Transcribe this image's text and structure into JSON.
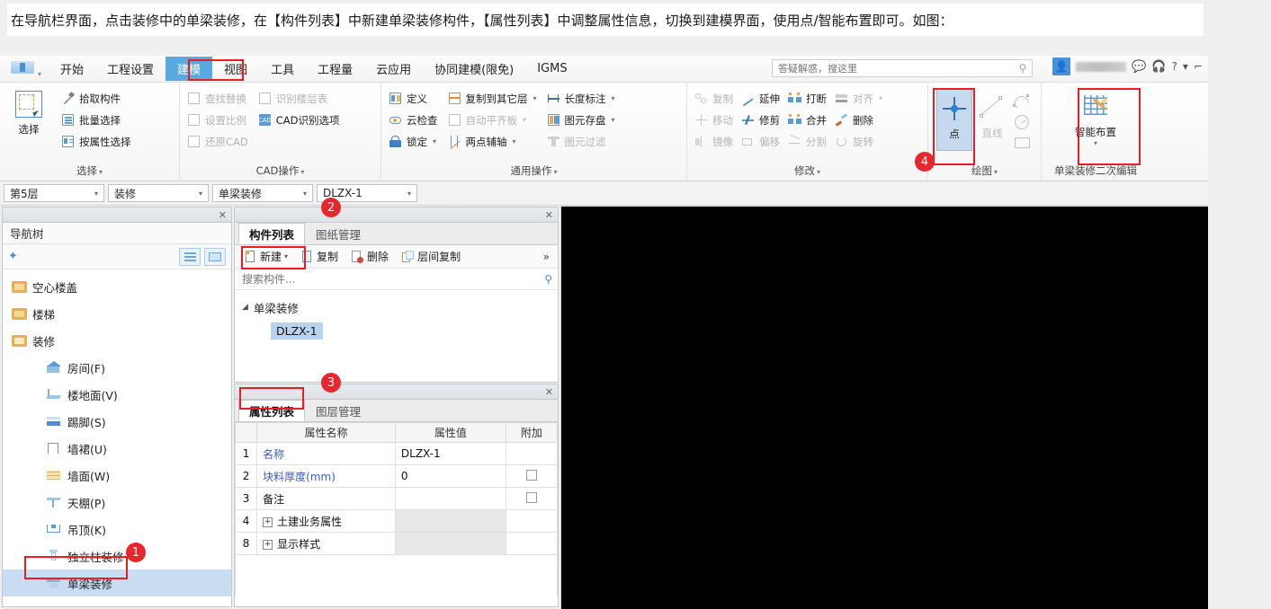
{
  "doc": {
    "paragraph": "在导航栏界面，点击装修中的单梁装修，在【构件列表】中新建单梁装修构件，【属性列表】中调整属性信息，切换到建模界面，使用点/智能布置即可。如图："
  },
  "menubar": {
    "items": [
      {
        "label": "开始",
        "active": false
      },
      {
        "label": "工程设置",
        "active": false
      },
      {
        "label": "建模",
        "active": true
      },
      {
        "label": "视图",
        "active": false
      },
      {
        "label": "工具",
        "active": false
      },
      {
        "label": "工程量",
        "active": false
      },
      {
        "label": "云应用",
        "active": false
      },
      {
        "label": "协同建模(限免)",
        "active": false
      },
      {
        "label": "IGMS",
        "active": false
      }
    ],
    "search_placeholder": "答疑解惑，搜这里",
    "icons": {
      "avatar": "avatar-icon",
      "chat": "chat-icon",
      "headset": "headset-icon",
      "help": "?",
      "help_caret": "▾"
    }
  },
  "ribbon": {
    "groups": [
      {
        "name": "选择",
        "label": "选择",
        "big": {
          "label": "选择"
        },
        "items": [
          {
            "label": "拾取构件",
            "disabled": false,
            "caret": false
          },
          {
            "label": "批量选择",
            "disabled": false,
            "caret": false
          },
          {
            "label": "按属性选择",
            "disabled": false,
            "caret": false
          }
        ]
      },
      {
        "name": "cad-operations",
        "label": "CAD操作",
        "cols": [
          [
            {
              "label": "查找替换",
              "disabled": true,
              "caret": false
            },
            {
              "label": "设置比例",
              "disabled": true,
              "caret": false
            },
            {
              "label": "还原CAD",
              "disabled": true,
              "caret": false
            }
          ],
          [
            {
              "label": "识别楼层表",
              "disabled": true,
              "caret": false
            },
            {
              "label": "CAD识别选项",
              "disabled": false,
              "caret": false
            }
          ]
        ]
      },
      {
        "name": "common-operations",
        "label": "通用操作",
        "cols": [
          [
            {
              "label": "定义",
              "disabled": false,
              "caret": false
            },
            {
              "label": "云检查",
              "disabled": false,
              "caret": false
            },
            {
              "label": "锁定",
              "disabled": false,
              "caret": true
            }
          ],
          [
            {
              "label": "复制到其它层",
              "disabled": false,
              "caret": true
            },
            {
              "label": "自动平齐板",
              "disabled": true,
              "caret": true
            },
            {
              "label": "两点辅轴",
              "disabled": false,
              "caret": true
            }
          ],
          [
            {
              "label": "长度标注",
              "disabled": false,
              "caret": true
            },
            {
              "label": "图元存盘",
              "disabled": false,
              "caret": true
            },
            {
              "label": "图元过滤",
              "disabled": true,
              "caret": false
            }
          ]
        ]
      },
      {
        "name": "modify",
        "label": "修改",
        "cols": [
          [
            {
              "label": "复制",
              "disabled": true,
              "caret": false
            },
            {
              "label": "移动",
              "disabled": true,
              "caret": false
            },
            {
              "label": "镜像",
              "disabled": true,
              "caret": false
            }
          ],
          [
            {
              "label": "延伸",
              "disabled": false,
              "caret": false
            },
            {
              "label": "修剪",
              "disabled": false,
              "caret": false
            },
            {
              "label": "偏移",
              "disabled": true,
              "caret": false
            }
          ],
          [
            {
              "label": "打断",
              "disabled": false,
              "caret": false
            },
            {
              "label": "合并",
              "disabled": false,
              "caret": false
            },
            {
              "label": "分割",
              "disabled": true,
              "caret": false
            }
          ],
          [
            {
              "label": "对齐",
              "disabled": true,
              "caret": true
            },
            {
              "label": "删除",
              "disabled": false,
              "caret": false
            },
            {
              "label": "旋转",
              "disabled": true,
              "caret": false
            }
          ]
        ]
      },
      {
        "name": "drawing",
        "label": "绘图",
        "point_label": "点",
        "line_label": "直线",
        "shapes": [
          "arc-icon",
          "circle-icon",
          "rect-icon"
        ]
      },
      {
        "name": "beam-decoration-secondary-edit",
        "label": "单梁装修二次编辑",
        "smart_label": "智能布置"
      }
    ]
  },
  "selectbar": {
    "floor": "第5层",
    "category": "装修",
    "component_type": "单梁装修",
    "component": "DLZX-1"
  },
  "nav_panel": {
    "title": "导航树",
    "close": "✕",
    "tree": [
      {
        "label": "空心楼盖",
        "type": "folder",
        "level": 0,
        "selected": false
      },
      {
        "label": "楼梯",
        "type": "folder",
        "level": 0,
        "selected": false
      },
      {
        "label": "装修",
        "type": "folder-open",
        "level": 0,
        "selected": false
      },
      {
        "label": "房间(F)",
        "type": "room-icon",
        "level": 1,
        "selected": false
      },
      {
        "label": "楼地面(V)",
        "type": "floor-icon",
        "level": 1,
        "selected": false
      },
      {
        "label": "踢脚(S)",
        "type": "skirting-icon",
        "level": 1,
        "selected": false
      },
      {
        "label": "墙裙(U)",
        "type": "wainscot-icon",
        "level": 1,
        "selected": false
      },
      {
        "label": "墙面(W)",
        "type": "wall-icon",
        "level": 1,
        "selected": false
      },
      {
        "label": "天棚(P)",
        "type": "ceiling-icon",
        "level": 1,
        "selected": false
      },
      {
        "label": "吊顶(K)",
        "type": "suspended-ceiling-icon",
        "level": 1,
        "selected": false
      },
      {
        "label": "独立柱装修",
        "type": "column-decoration-icon",
        "level": 1,
        "selected": false
      },
      {
        "label": "单梁装修",
        "type": "beam-decoration-icon",
        "level": 1,
        "selected": true
      }
    ]
  },
  "component_panel": {
    "close": "✕",
    "tabs": [
      {
        "label": "构件列表",
        "active": true
      },
      {
        "label": "图纸管理",
        "active": false
      }
    ],
    "buttons": [
      {
        "label": "新建",
        "caret": "▾"
      },
      {
        "label": "复制",
        "caret": ""
      },
      {
        "label": "删除",
        "caret": ""
      },
      {
        "label": "层间复制",
        "caret": ""
      }
    ],
    "more": "»",
    "search_placeholder": "搜索构件...",
    "tree": {
      "group": "单梁装修",
      "arrow": "◢",
      "items": [
        "DLZX-1"
      ]
    }
  },
  "property_panel": {
    "close": "✕",
    "tabs": [
      {
        "label": "属性列表",
        "active": true
      },
      {
        "label": "图层管理",
        "active": false
      }
    ],
    "headers": [
      "",
      "属性名称",
      "属性值",
      "附加"
    ],
    "rows": [
      {
        "index": "1",
        "name": "名称",
        "value": "DLZX-1",
        "attach": "none",
        "blue": true,
        "expandable": false,
        "value_gray": false
      },
      {
        "index": "2",
        "name": "块料厚度(mm)",
        "value": "0",
        "attach": "checkbox",
        "blue": true,
        "expandable": false,
        "value_gray": false
      },
      {
        "index": "3",
        "name": "备注",
        "value": "",
        "attach": "checkbox",
        "blue": false,
        "expandable": false,
        "value_gray": false
      },
      {
        "index": "4",
        "name": "土建业务属性",
        "value": "",
        "attach": "none",
        "blue": false,
        "expandable": true,
        "value_gray": true
      },
      {
        "index": "8",
        "name": "显示样式",
        "value": "",
        "attach": "none",
        "blue": false,
        "expandable": true,
        "value_gray": true
      }
    ]
  },
  "annotations": [
    {
      "number": "1",
      "target": "nav-tree-item-beam-decoration"
    },
    {
      "number": "2",
      "target": "component-new-button"
    },
    {
      "number": "3",
      "target": "property-list-tab"
    },
    {
      "number": "4",
      "target": "drawing-point-button"
    }
  ],
  "colors": {
    "accent": "#5aaae2",
    "annotation_red": "#ec1c24",
    "badge_red": "#e8262d",
    "selection_blue": "#c9ddf2",
    "icon_blue": "#5b9bd5",
    "canvas": "#000000"
  }
}
